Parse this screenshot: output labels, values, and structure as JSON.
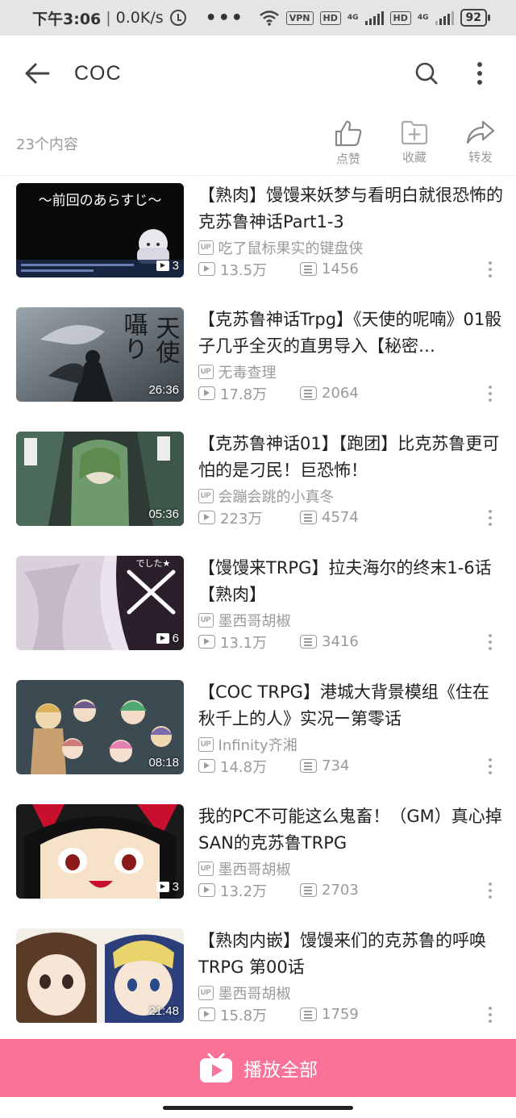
{
  "status_bar": {
    "time": "下午3:06",
    "net_speed": "0.0K/s",
    "more": "•••",
    "vpn": "VPN",
    "hd1": "HD",
    "hd2": "HD",
    "net1": "4G",
    "net2": "4G",
    "battery": "92"
  },
  "app_bar": {
    "title": "COC"
  },
  "list_header": {
    "count": "23个内容",
    "like_label": "点赞",
    "fav_label": "收藏",
    "share_label": "转发"
  },
  "videos": [
    {
      "title": "【熟肉】馒馒来妖梦与看明白就很恐怖的克苏鲁神话Part1-3",
      "author": "吃了鼠标果实的键盘侠",
      "views": "13.5万",
      "danmaku": "1456",
      "badge": "3",
      "badge_type": "playlist"
    },
    {
      "title": "【克苏鲁神话Trpg】《天使的呢喃》01骰子几乎全灭的直男导入【秘密…",
      "author": "无毒查理",
      "views": "17.8万",
      "danmaku": "2064",
      "badge": "26:36",
      "badge_type": "duration"
    },
    {
      "title": "【克苏鲁神话01】【跑团】比克苏鲁更可怕的是刁民！巨恐怖！",
      "author": "会蹦会跳的小真冬",
      "views": "223万",
      "danmaku": "4574",
      "badge": "05:36",
      "badge_type": "duration"
    },
    {
      "title": "【馒馒来TRPG】拉夫海尔的终末1-6话【熟肉】",
      "author": "墨西哥胡椒",
      "views": "13.1万",
      "danmaku": "3416",
      "badge": "6",
      "badge_type": "playlist"
    },
    {
      "title": "【COC TRPG】港城大背景模组《住在秋千上的人》实况ー第零话",
      "author": "Infinity齐湘",
      "views": "14.8万",
      "danmaku": "734",
      "badge": "08:18",
      "badge_type": "duration"
    },
    {
      "title": "我的PC不可能这么鬼畜！（GM）真心掉SAN的克苏鲁TRPG",
      "author": "墨西哥胡椒",
      "views": "13.2万",
      "danmaku": "2703",
      "badge": "3",
      "badge_type": "playlist"
    },
    {
      "title": "【熟肉内嵌】馒馒来们的克苏鲁的呼唤TRPG 第00话",
      "author": "墨西哥胡椒",
      "views": "15.8万",
      "danmaku": "1759",
      "badge": "21:48",
      "badge_type": "duration"
    }
  ],
  "thumb_texts": {
    "t1_caption": "～前回のあらすじ～",
    "t2_line1": "天使",
    "t2_line2": "囁り",
    "t4_caption": "でした★"
  },
  "play_all": {
    "label": "播放全部"
  },
  "colors": {
    "accent": "#fb7299",
    "secondary_text": "#9a9a9a"
  }
}
